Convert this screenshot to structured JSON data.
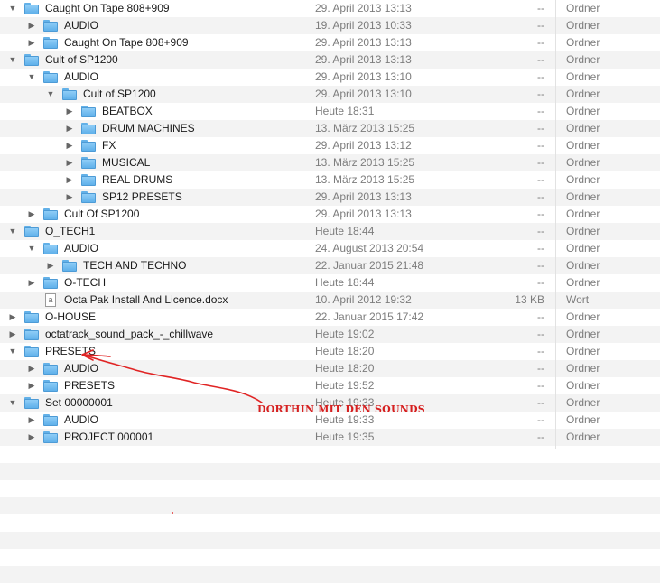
{
  "rows": [
    {
      "level": 0,
      "expanded": true,
      "type": "folder",
      "name": "Caught On Tape 808+909",
      "date": "29. April 2013 13:13",
      "size": "--",
      "kind": "Ordner"
    },
    {
      "level": 1,
      "expanded": false,
      "type": "folder",
      "name": "AUDIO",
      "date": "19. April 2013 10:33",
      "size": "--",
      "kind": "Ordner"
    },
    {
      "level": 1,
      "expanded": false,
      "type": "folder",
      "name": "Caught On Tape 808+909",
      "date": "29. April 2013 13:13",
      "size": "--",
      "kind": "Ordner"
    },
    {
      "level": 0,
      "expanded": true,
      "type": "folder",
      "name": "Cult of SP1200",
      "date": "29. April 2013 13:13",
      "size": "--",
      "kind": "Ordner"
    },
    {
      "level": 1,
      "expanded": true,
      "type": "folder",
      "name": "AUDIO",
      "date": "29. April 2013 13:10",
      "size": "--",
      "kind": "Ordner"
    },
    {
      "level": 2,
      "expanded": true,
      "type": "folder",
      "name": "Cult of SP1200",
      "date": "29. April 2013 13:10",
      "size": "--",
      "kind": "Ordner"
    },
    {
      "level": 3,
      "expanded": false,
      "type": "folder",
      "name": "BEATBOX",
      "date": "Heute 18:31",
      "size": "--",
      "kind": "Ordner"
    },
    {
      "level": 3,
      "expanded": false,
      "type": "folder",
      "name": "DRUM MACHINES",
      "date": "13. März 2013 15:25",
      "size": "--",
      "kind": "Ordner"
    },
    {
      "level": 3,
      "expanded": false,
      "type": "folder",
      "name": "FX",
      "date": "29. April 2013 13:12",
      "size": "--",
      "kind": "Ordner"
    },
    {
      "level": 3,
      "expanded": false,
      "type": "folder",
      "name": "MUSICAL",
      "date": "13. März 2013 15:25",
      "size": "--",
      "kind": "Ordner"
    },
    {
      "level": 3,
      "expanded": false,
      "type": "folder",
      "name": "REAL DRUMS",
      "date": "13. März 2013 15:25",
      "size": "--",
      "kind": "Ordner"
    },
    {
      "level": 3,
      "expanded": false,
      "type": "folder",
      "name": "SP12 PRESETS",
      "date": "29. April 2013 13:13",
      "size": "--",
      "kind": "Ordner"
    },
    {
      "level": 1,
      "expanded": false,
      "type": "folder",
      "name": "Cult Of SP1200",
      "date": "29. April 2013 13:13",
      "size": "--",
      "kind": "Ordner"
    },
    {
      "level": 0,
      "expanded": true,
      "type": "folder",
      "name": "O_TECH1",
      "date": "Heute 18:44",
      "size": "--",
      "kind": "Ordner"
    },
    {
      "level": 1,
      "expanded": true,
      "type": "folder",
      "name": "AUDIO",
      "date": "24. August 2013 20:54",
      "size": "--",
      "kind": "Ordner"
    },
    {
      "level": 2,
      "expanded": false,
      "type": "folder",
      "name": "TECH AND TECHNO",
      "date": "22. Januar 2015 21:48",
      "size": "--",
      "kind": "Ordner"
    },
    {
      "level": 1,
      "expanded": false,
      "type": "folder",
      "name": "O-TECH",
      "date": "Heute 18:44",
      "size": "--",
      "kind": "Ordner"
    },
    {
      "level": 1,
      "expanded": null,
      "type": "doc",
      "name": "Octa Pak Install And Licence.docx",
      "date": "10. April 2012 19:32",
      "size": "13 KB",
      "kind": "Wort"
    },
    {
      "level": 0,
      "expanded": false,
      "type": "folder",
      "name": "O-HOUSE",
      "date": "22. Januar 2015 17:42",
      "size": "--",
      "kind": "Ordner"
    },
    {
      "level": 0,
      "expanded": false,
      "type": "folder",
      "name": "octatrack_sound_pack_-_chillwave",
      "date": "Heute 19:02",
      "size": "--",
      "kind": "Ordner"
    },
    {
      "level": 0,
      "expanded": true,
      "type": "folder",
      "name": "PRESETS",
      "date": "Heute 18:20",
      "size": "--",
      "kind": "Ordner"
    },
    {
      "level": 1,
      "expanded": false,
      "type": "folder",
      "name": "AUDIO",
      "date": "Heute 18:20",
      "size": "--",
      "kind": "Ordner"
    },
    {
      "level": 1,
      "expanded": false,
      "type": "folder",
      "name": "PRESETS",
      "date": "Heute 19:52",
      "size": "--",
      "kind": "Ordner"
    },
    {
      "level": 0,
      "expanded": true,
      "type": "folder",
      "name": "Set 00000001",
      "date": "Heute 19:33",
      "size": "--",
      "kind": "Ordner"
    },
    {
      "level": 1,
      "expanded": false,
      "type": "folder",
      "name": "AUDIO",
      "date": "Heute 19:33",
      "size": "--",
      "kind": "Ordner"
    },
    {
      "level": 1,
      "expanded": false,
      "type": "folder",
      "name": "PROJECT 000001",
      "date": "Heute 19:35",
      "size": "--",
      "kind": "Ordner"
    }
  ],
  "empty_rows": 8,
  "annotation": {
    "text": "DORTHIN MIT DEN SOUNDS",
    "color": "#d62020"
  },
  "icons": {
    "expanded": "disclosure-triangle-down-icon",
    "collapsed": "disclosure-triangle-right-icon",
    "folder": "folder-icon",
    "doc": "word-document-icon"
  }
}
